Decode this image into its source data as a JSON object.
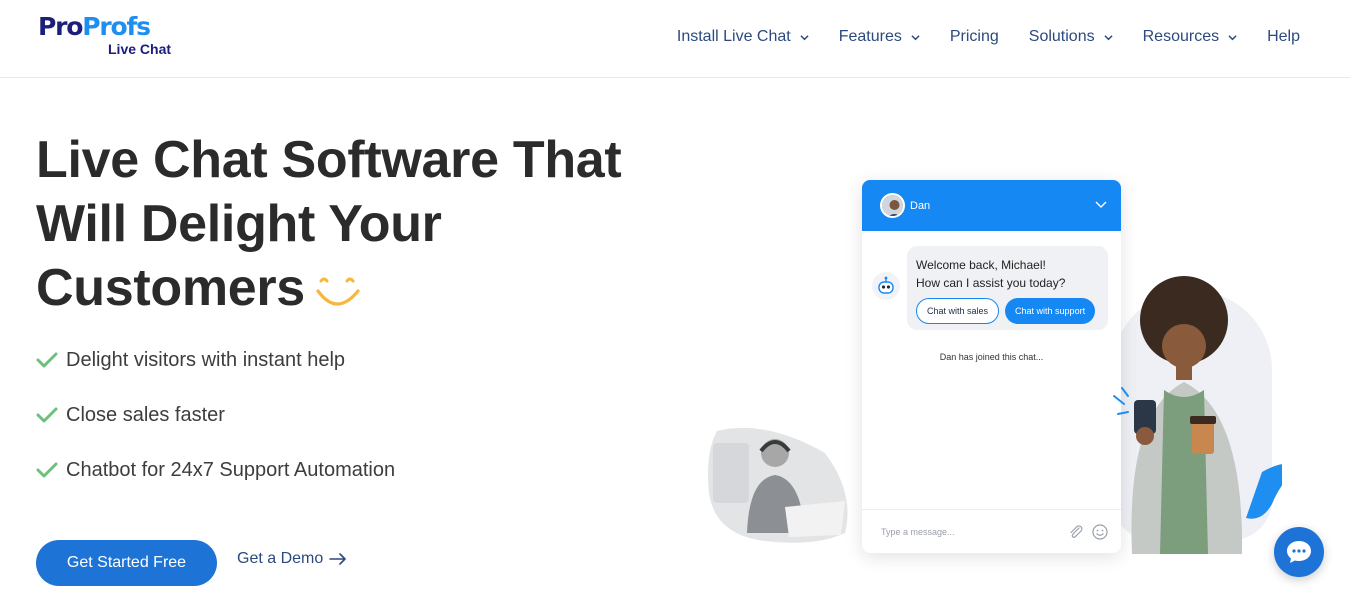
{
  "brand": {
    "name_part1": "Pro",
    "name_part2": "Profs",
    "product": "Live Chat"
  },
  "nav": [
    {
      "label": "Install Live Chat",
      "has_dropdown": true
    },
    {
      "label": "Features",
      "has_dropdown": true
    },
    {
      "label": "Pricing",
      "has_dropdown": false
    },
    {
      "label": "Solutions",
      "has_dropdown": true
    },
    {
      "label": "Resources",
      "has_dropdown": true
    },
    {
      "label": "Help",
      "has_dropdown": false
    }
  ],
  "hero": {
    "title_line1": "Live Chat Software That",
    "title_line2": "Will Delight Your",
    "title_line3": "Customers",
    "bullets": [
      "Delight visitors with instant help",
      "Close sales faster",
      "Chatbot for 24x7 Support Automation"
    ],
    "primary_cta": "Get Started Free",
    "secondary_cta": "Get a Demo"
  },
  "chat_widget": {
    "agent_name": "Dan",
    "message_line1": "Welcome back, Michael!",
    "message_line2": "How can I assist you today?",
    "option_sales": "Chat with sales",
    "option_support": "Chat with support",
    "status": "Dan has joined this chat...",
    "input_placeholder": "Type a message..."
  },
  "colors": {
    "brand_navy": "#1b1e7a",
    "brand_blue": "#1f8ef1",
    "nav_text": "#2c4a7e",
    "primary_button": "#1d74d6",
    "chat_header": "#1688f4",
    "check_green": "#6cc17a",
    "smiley_yellow": "#f6b73c"
  },
  "icons": [
    "chevron-down-icon",
    "smiley-icon",
    "check-icon",
    "arrow-right-icon",
    "bot-icon",
    "attachment-icon",
    "emoji-icon",
    "chat-bubble-icon"
  ]
}
